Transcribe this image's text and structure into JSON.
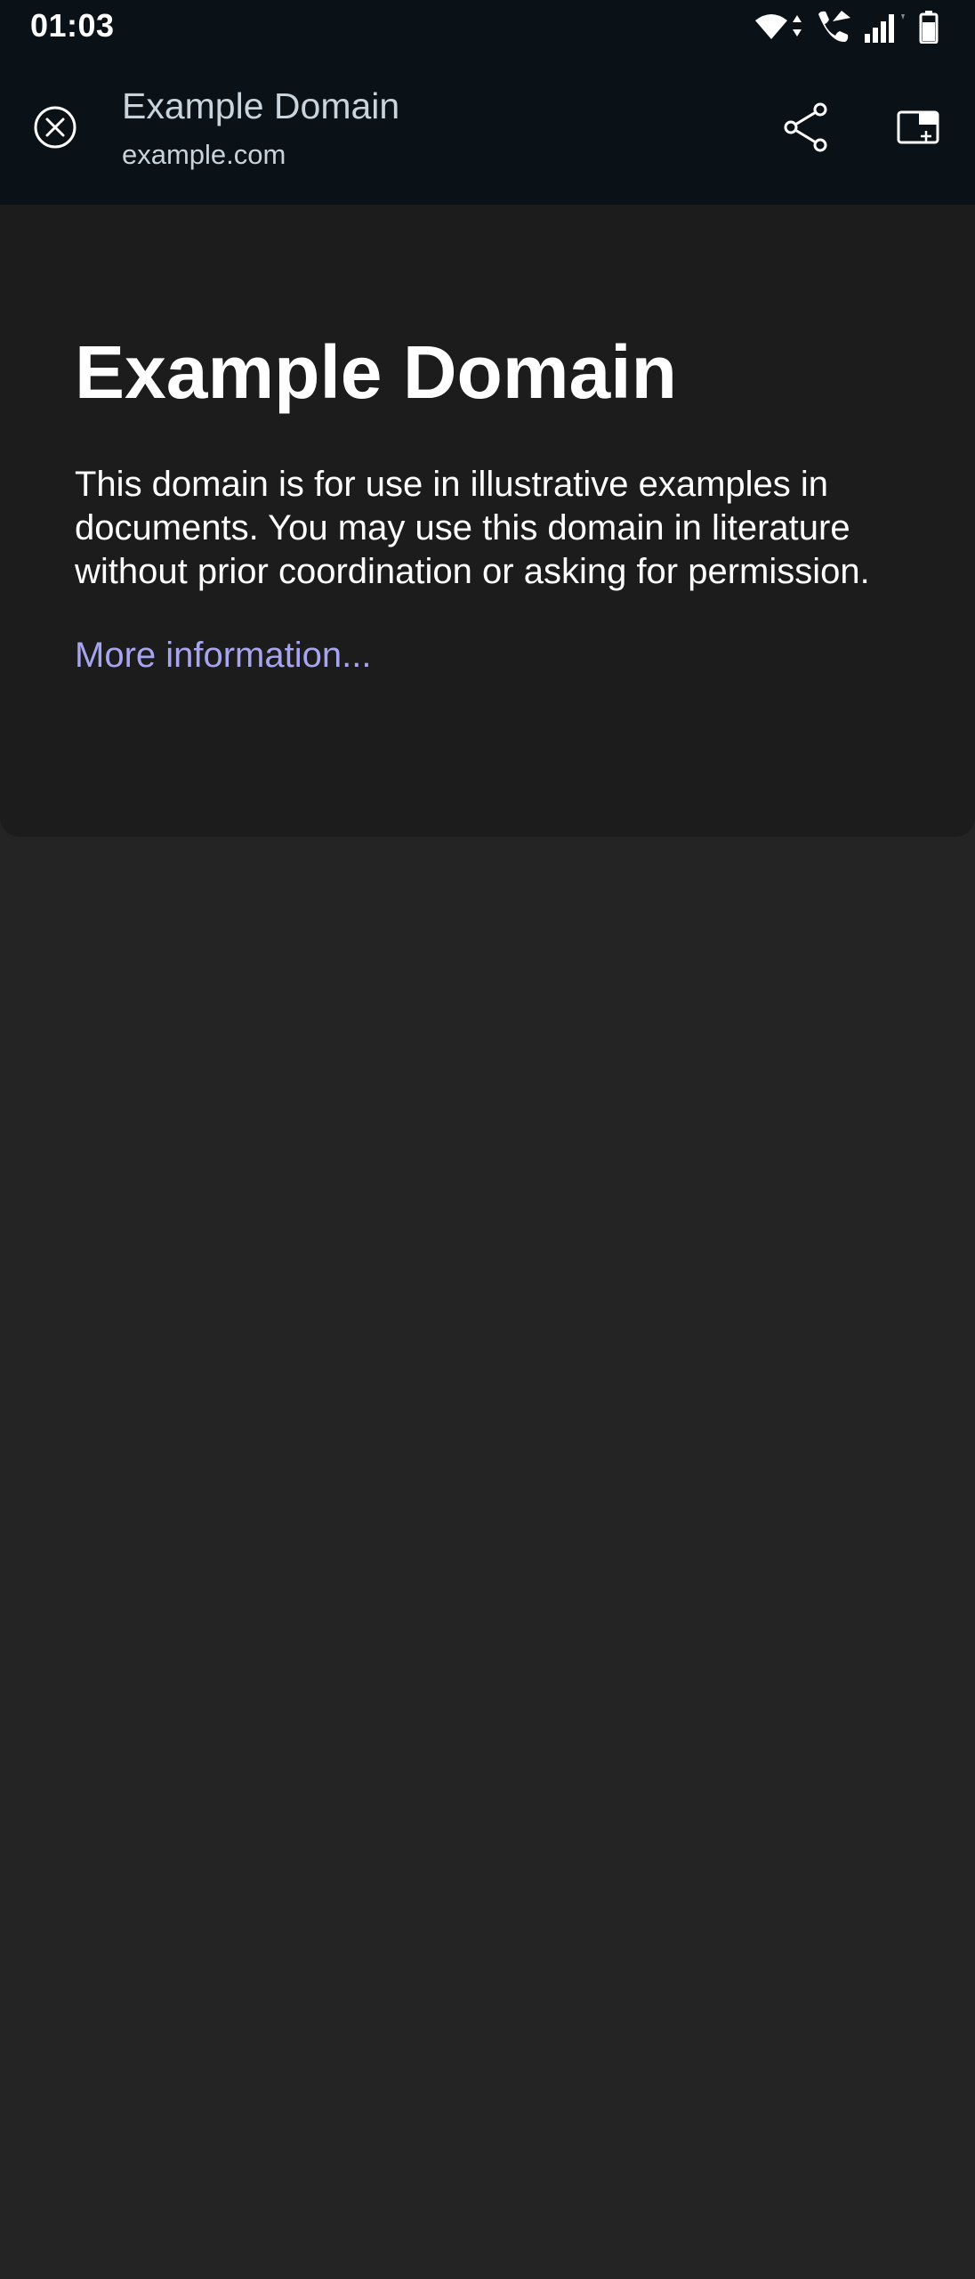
{
  "status_bar": {
    "time": "01:03",
    "icons": [
      "wifi-icon",
      "wifi-activity-arrows-icon",
      "wifi-calling-icon",
      "cell-signal-icon",
      "battery-icon"
    ]
  },
  "toolbar": {
    "title": "Example Domain",
    "url": "example.com",
    "close_icon": "close-circle-icon",
    "share_icon": "share-icon",
    "pip_icon": "picture-in-picture-icon"
  },
  "content": {
    "heading": "Example Domain",
    "body": "This domain is for use in illustrative examples in documents. You may use this domain in literature without prior coordination or asking for permission.",
    "link": "More information..."
  },
  "colors": {
    "toolbar_bg": "#0b1217",
    "content_bg": "#1c1c1c",
    "page_bg": "#242424",
    "link": "#a7a4f0",
    "toolbar_text": "#c9d3dc"
  }
}
